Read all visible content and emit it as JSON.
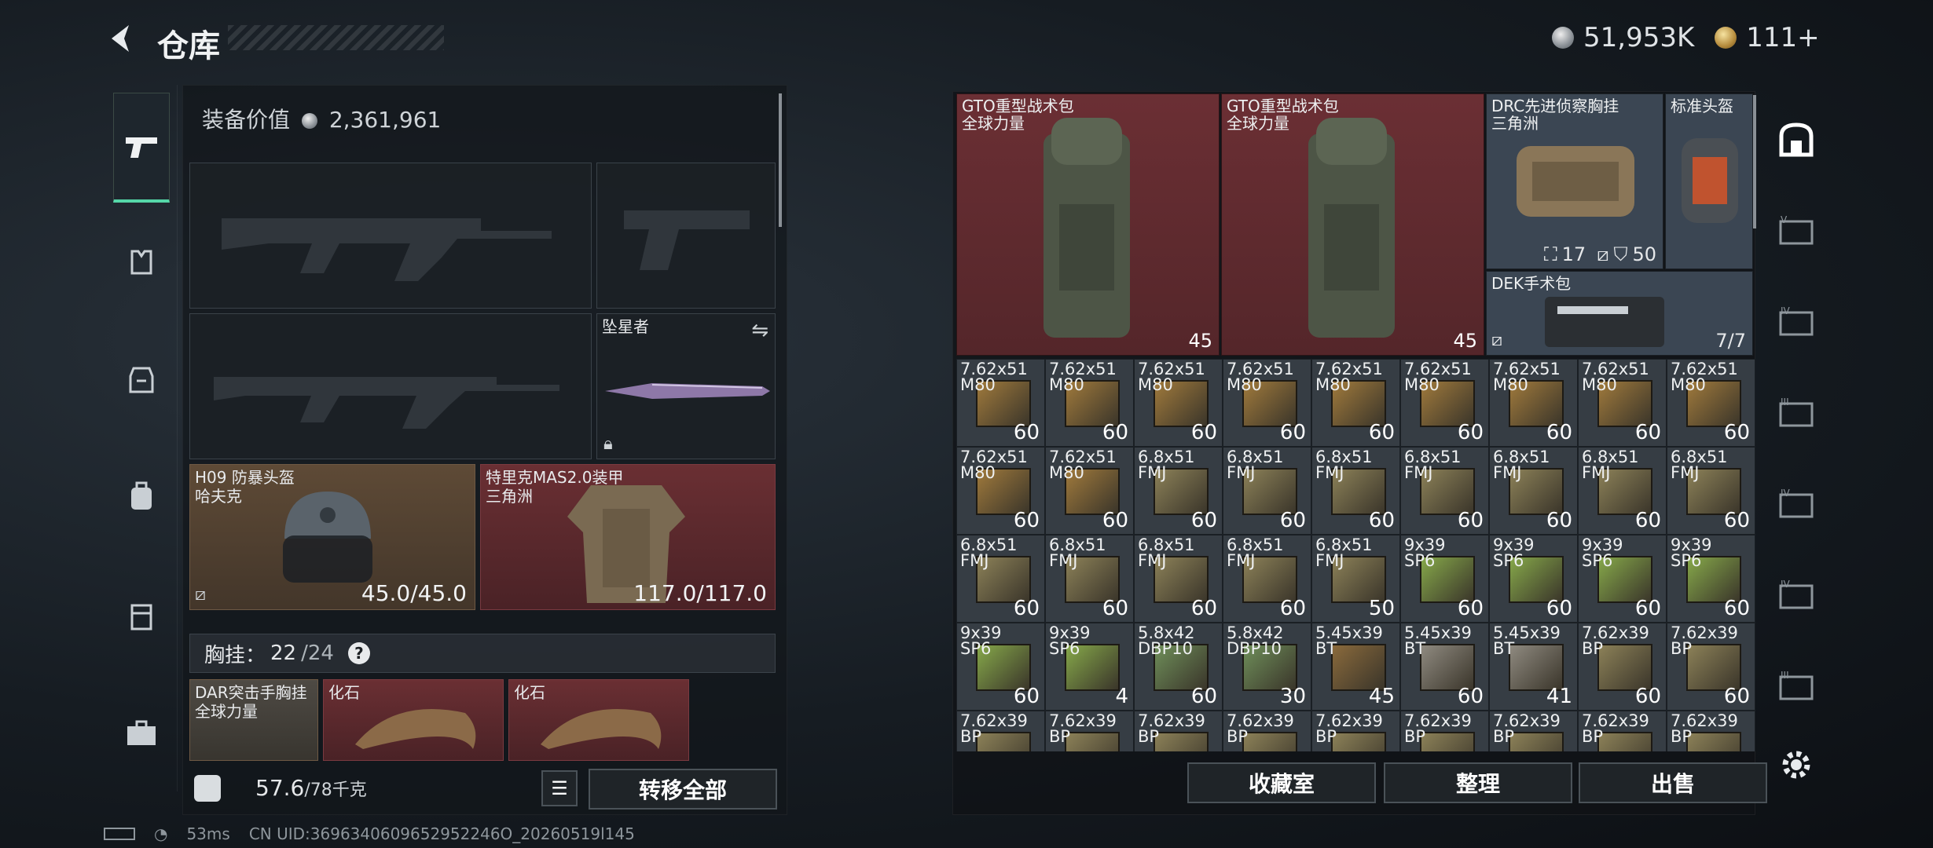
{
  "header": {
    "title": "仓库",
    "currency": {
      "silver": "51,953K",
      "gold": "111+"
    }
  },
  "left_nav": [
    "weapon-icon",
    "vest-icon",
    "armor-icon",
    "backpack-icon",
    "pouch-icon",
    "case-icon"
  ],
  "equipment": {
    "value_label": "装备价值",
    "value": "2,361,961",
    "melee": {
      "name": "坠星者"
    },
    "helmet": {
      "name": "H09 防暴头盔\n哈夫克",
      "durability": "45.0/45.0"
    },
    "armor": {
      "name": "特里克MAS2.0装甲\n三角洲",
      "durability": "117.0/117.0"
    },
    "chest_rig": {
      "label": "胸挂：",
      "count": "22",
      "capacity": "/24",
      "help": "?"
    },
    "rig_items": [
      {
        "name": "DAR突击手胸挂\n全球力量"
      },
      {
        "name": "化石"
      },
      {
        "name": "化石"
      }
    ],
    "weight": {
      "current": "57.6",
      "max": "/78千克"
    },
    "transfer_all": "转移全部"
  },
  "stash": {
    "big_items": [
      {
        "name": "GTO重型战术包\n全球力量",
        "count": "45"
      },
      {
        "name": "GTO重型战术包\n全球力量",
        "count": "45"
      }
    ],
    "drc": {
      "name": "DRC先进侦察胸挂\n三角洲",
      "slots": "17",
      "armor": "50"
    },
    "std_helmet": {
      "name": "标准头盔"
    },
    "dek": {
      "name": "DEK手术包",
      "uses": "7/7"
    },
    "ammo_rows": [
      [
        {
          "n": "7.62x51\nM80",
          "q": "60",
          "c": "#a07a3c"
        },
        {
          "n": "7.62x51\nM80",
          "q": "60",
          "c": "#a07a3c"
        },
        {
          "n": "7.62x51\nM80",
          "q": "60",
          "c": "#a07a3c"
        },
        {
          "n": "7.62x51\nM80",
          "q": "60",
          "c": "#a07a3c"
        },
        {
          "n": "7.62x51\nM80",
          "q": "60",
          "c": "#a07a3c"
        },
        {
          "n": "7.62x51\nM80",
          "q": "60",
          "c": "#a07a3c"
        },
        {
          "n": "7.62x51\nM80",
          "q": "60",
          "c": "#a07a3c"
        },
        {
          "n": "7.62x51\nM80",
          "q": "60",
          "c": "#a07a3c"
        },
        {
          "n": "7.62x51\nM80",
          "q": "60",
          "c": "#a07a3c"
        }
      ],
      [
        {
          "n": "7.62x51\nM80",
          "q": "60",
          "c": "#a07a3c"
        },
        {
          "n": "7.62x51\nM80",
          "q": "60",
          "c": "#a07a3c"
        },
        {
          "n": "6.8x51\nFMJ",
          "q": "60",
          "c": "#8c8158"
        },
        {
          "n": "6.8x51\nFMJ",
          "q": "60",
          "c": "#8c8158"
        },
        {
          "n": "6.8x51\nFMJ",
          "q": "60",
          "c": "#8c8158"
        },
        {
          "n": "6.8x51\nFMJ",
          "q": "60",
          "c": "#8c8158"
        },
        {
          "n": "6.8x51\nFMJ",
          "q": "60",
          "c": "#8c8158"
        },
        {
          "n": "6.8x51\nFMJ",
          "q": "60",
          "c": "#8c8158"
        },
        {
          "n": "6.8x51\nFMJ",
          "q": "60",
          "c": "#8c8158"
        }
      ],
      [
        {
          "n": "6.8x51\nFMJ",
          "q": "60",
          "c": "#8c8158"
        },
        {
          "n": "6.8x51\nFMJ",
          "q": "60",
          "c": "#8c8158"
        },
        {
          "n": "6.8x51\nFMJ",
          "q": "60",
          "c": "#8c8158"
        },
        {
          "n": "6.8x51\nFMJ",
          "q": "60",
          "c": "#8c8158"
        },
        {
          "n": "6.8x51\nFMJ",
          "q": "50",
          "c": "#8c8158"
        },
        {
          "n": "9x39\nSP6",
          "q": "60",
          "c": "#86a84a"
        },
        {
          "n": "9x39\nSP6",
          "q": "60",
          "c": "#86a84a"
        },
        {
          "n": "9x39\nSP6",
          "q": "60",
          "c": "#86a84a"
        },
        {
          "n": "9x39\nSP6",
          "q": "60",
          "c": "#86a84a"
        }
      ],
      [
        {
          "n": "9x39\nSP6",
          "q": "60",
          "c": "#86a84a"
        },
        {
          "n": "9x39\nSP6",
          "q": "4",
          "c": "#86a84a"
        },
        {
          "n": "5.8x42\nDBP10",
          "q": "60",
          "c": "#6f8f5a"
        },
        {
          "n": "5.8x42\nDBP10",
          "q": "30",
          "c": "#6f8f5a"
        },
        {
          "n": "5.45x39\nBT",
          "q": "45",
          "c": "#8a6a3c"
        },
        {
          "n": "5.45x39\nBT",
          "q": "60",
          "c": "#8f8a80"
        },
        {
          "n": "5.45x39\nBT",
          "q": "41",
          "c": "#8f8a80"
        },
        {
          "n": "7.62x39\nBP",
          "q": "60",
          "c": "#8c8158"
        },
        {
          "n": "7.62x39\nBP",
          "q": "60",
          "c": "#8c8158"
        }
      ],
      [
        {
          "n": "7.62x39\nBP",
          "q": "",
          "c": "#8c8158"
        },
        {
          "n": "7.62x39\nBP",
          "q": "",
          "c": "#8c8158"
        },
        {
          "n": "7.62x39\nBP",
          "q": "",
          "c": "#8c8158"
        },
        {
          "n": "7.62x39\nBP",
          "q": "",
          "c": "#8c8158"
        },
        {
          "n": "7.62x39\nBP",
          "q": "",
          "c": "#8c8158"
        },
        {
          "n": "7.62x39\nBP",
          "q": "",
          "c": "#8c8158"
        },
        {
          "n": "7.62x39\nBP",
          "q": "",
          "c": "#8c8158"
        },
        {
          "n": "7.62x39\nBP",
          "q": "",
          "c": "#8c8158"
        },
        {
          "n": "7.62x39\nBP",
          "q": "",
          "c": "#8c8158"
        }
      ]
    ],
    "buttons": {
      "collection": "收藏室",
      "sort": "整理",
      "sell": "出售"
    }
  },
  "right_nav": [
    "stash-main-icon",
    "stash-5-icon",
    "stash-4-icon",
    "stash-3-icon",
    "stash-4b-icon",
    "stash-4c-icon",
    "stash-3b-icon"
  ],
  "status": {
    "ping": "53ms",
    "uid": "CN UID:3696340609652952246O_20260519l145"
  }
}
